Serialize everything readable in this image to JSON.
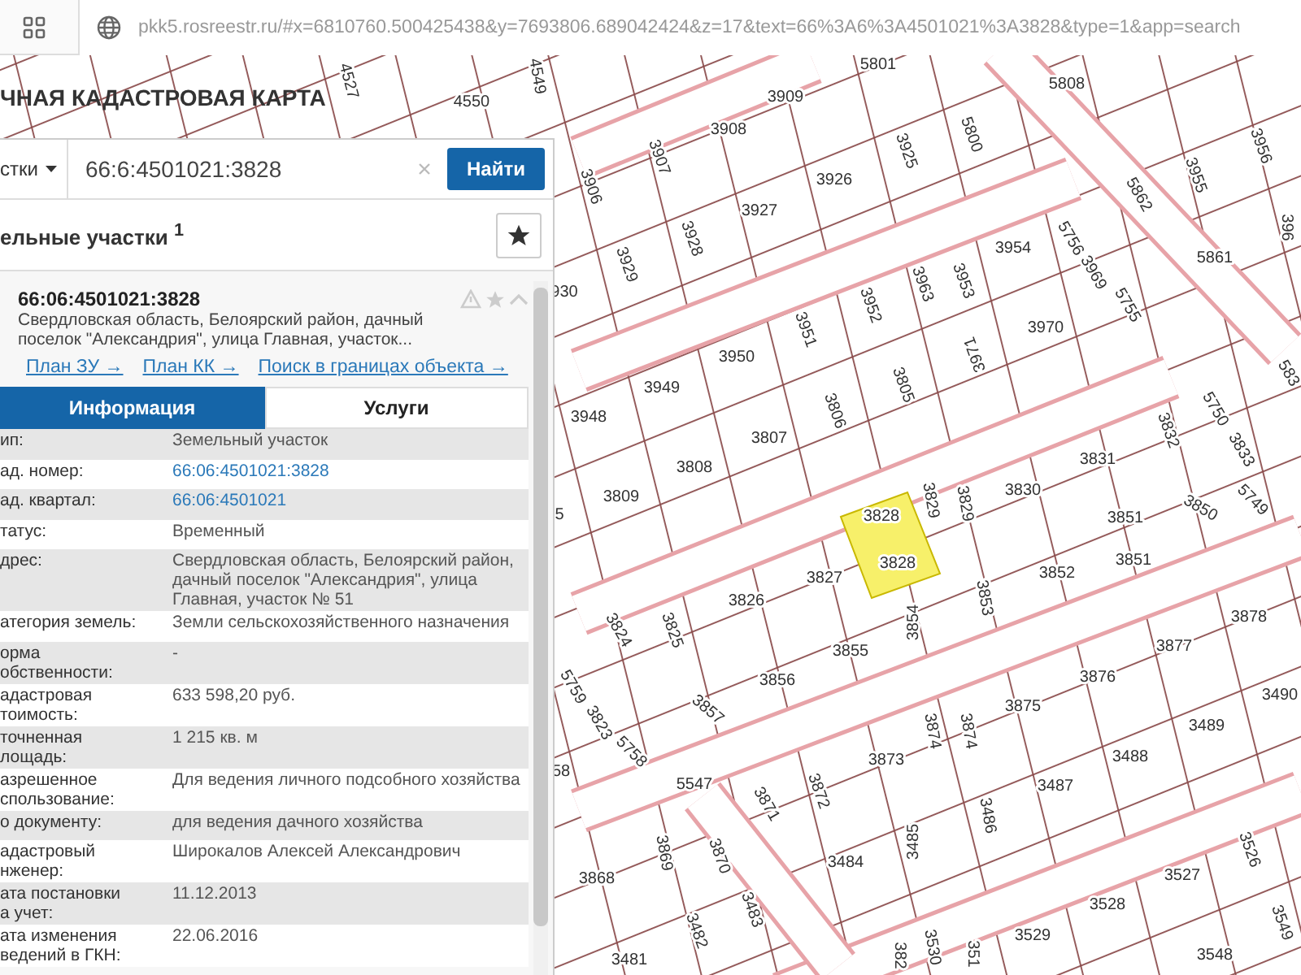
{
  "browser": {
    "url": "pkk5.rosreestr.ru/#x=6810760.500425438&y=7693806.689042424&z=17&text=66%3A6%3A4501021%3A3828&type=1&app=search"
  },
  "map": {
    "title": "ЧНАЯ КАДАСТРОВАЯ КАРТА",
    "parcel_labels": [
      "4527",
      "4550",
      "4549",
      "5801",
      "3909",
      "5808",
      "3908",
      "3906",
      "3907",
      "3925",
      "5800",
      "3926",
      "3927",
      "3929",
      "3928",
      "3954",
      "5756",
      "3969",
      "5755",
      "5862",
      "3955",
      "3956",
      "5861",
      "396",
      "930",
      "3952",
      "3963",
      "3953",
      "3951",
      "3950",
      "3970",
      "3971",
      "3949",
      "3948",
      "3805",
      "3806",
      "3807",
      "3808",
      "3809",
      "3831",
      "3832",
      "5750",
      "3833",
      "3830",
      "3829",
      "3829",
      "3850",
      "5749",
      "583",
      "5",
      "3828",
      "3828",
      "3827",
      "3826",
      "3825",
      "3824",
      "3851",
      "3851",
      "3852",
      "3853",
      "3854",
      "3855",
      "3856",
      "3857",
      "5759",
      "3823",
      "5758",
      "58",
      "3878",
      "3877",
      "3876",
      "3875",
      "3874",
      "3874",
      "3873",
      "3490",
      "3489",
      "3488",
      "3487",
      "5547",
      "3871",
      "3872",
      "3486",
      "3485",
      "3484",
      "3868",
      "3869",
      "3870",
      "3483",
      "3482",
      "3481",
      "3526",
      "3527",
      "3528",
      "3529",
      "3549",
      "3548",
      "3530",
      "351",
      "382"
    ]
  },
  "panel": {
    "search": {
      "scope": "стки",
      "value": "66:6:4501021:3828",
      "button": "Найти"
    },
    "section": {
      "title": "ельные участки $^{1}$"
    },
    "result": {
      "number": "66:06:4501021:3828",
      "address": "Свердловская область, Белоярский район, дачный поселок \"Александрия\", улица Главная, участок...",
      "links": [
        "План ЗУ →",
        "План КК →",
        "Поиск в границах объекта →"
      ]
    },
    "tabs": [
      {
        "label": "Информация",
        "selected": true
      },
      {
        "label": "Услуги",
        "selected": false
      }
    ],
    "rows": [
      {
        "key": "ип:",
        "value": "Земельный участок",
        "kind": "text"
      },
      {
        "key": "ад. номер:",
        "value": "66:06:4501021:3828",
        "kind": "link"
      },
      {
        "key": "ад. квартал:",
        "value": "66:06:4501021",
        "kind": "link"
      },
      {
        "key": "татус:",
        "value": "Временный",
        "kind": "text"
      },
      {
        "key": "дрес:",
        "value": "Свердловская область, Белоярский район, дачный поселок \"Александрия\", улица Главная, участок № 51",
        "kind": "text"
      },
      {
        "key": "атегория земель:",
        "value": "Земли сельскохозяйственного назначения",
        "kind": "text"
      },
      {
        "key": "орма\nобственности:",
        "value": "-",
        "kind": "text"
      },
      {
        "key": "адастровая\nтоимость:",
        "value": "633 598,20 руб.",
        "kind": "text"
      },
      {
        "key": "точненная\nлощадь:",
        "value": "1 215 кв. м",
        "kind": "text"
      },
      {
        "key": "азрешенное\nспользование:",
        "value": "Для ведения личного подсобного хозяйства",
        "kind": "text"
      },
      {
        "key": "о документу:",
        "value": "для ведения дачного хозяйства",
        "kind": "text"
      },
      {
        "key": "адастровый\nнженер:",
        "value": "Широкалов Алексей Александрович",
        "kind": "text"
      },
      {
        "key": "ата постановки\nа учет:",
        "value": "11.12.2013",
        "kind": "text"
      },
      {
        "key": "ата изменения\nведений в ГКН:",
        "value": "22.06.2016",
        "kind": "text"
      }
    ]
  }
}
